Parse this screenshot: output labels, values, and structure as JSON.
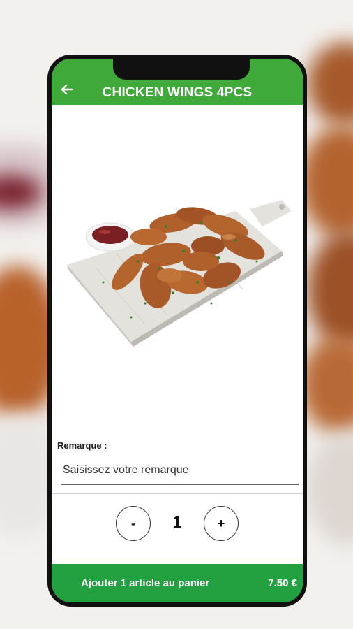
{
  "header": {
    "title": "CHICKEN WINGS 4PCS",
    "back_icon": "arrow-left-icon",
    "color": "#3fa93a"
  },
  "product": {
    "image": "chicken-wings-on-board-with-dipping-sauce"
  },
  "remark": {
    "label": "Remarque :",
    "placeholder": "Saisissez votre remarque",
    "value": ""
  },
  "quantity": {
    "minus_label": "-",
    "value": "1",
    "plus_label": "+"
  },
  "cart": {
    "label": "Ajouter 1 article au panier",
    "price": "7.50 €",
    "color": "#23a040"
  }
}
